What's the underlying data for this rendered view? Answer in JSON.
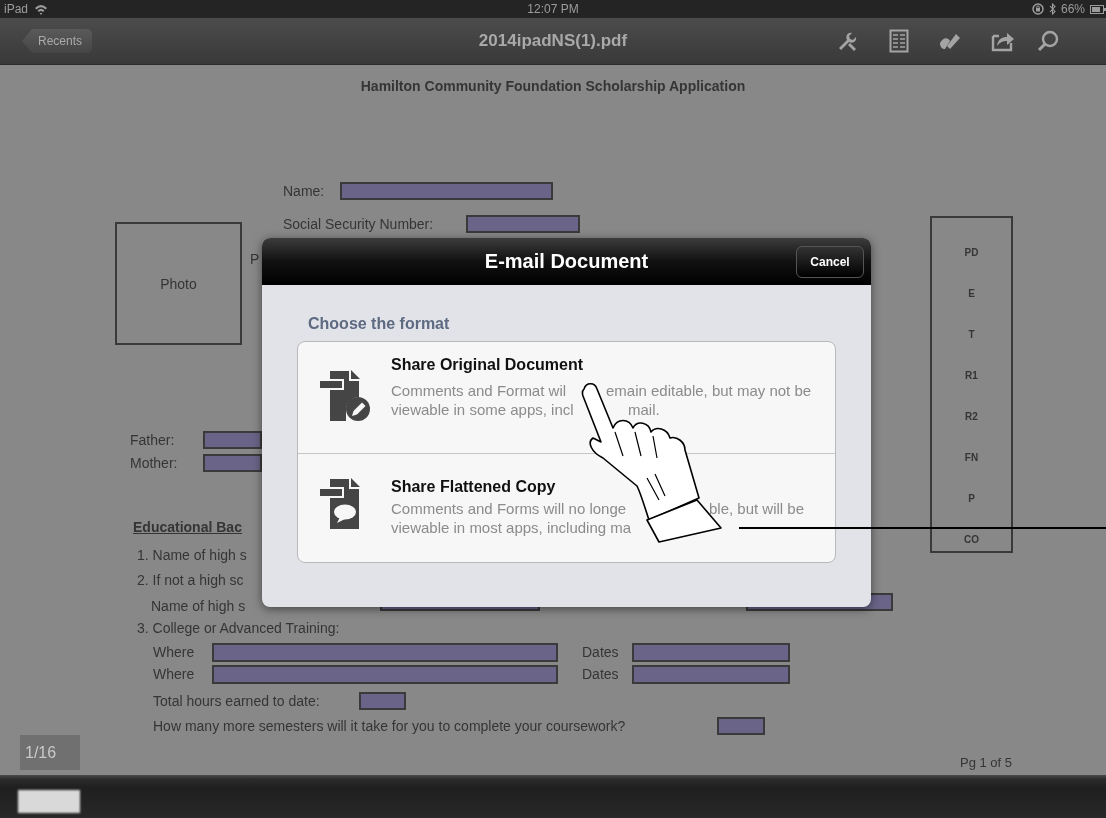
{
  "status_bar": {
    "device": "iPad",
    "time": "12:07 PM",
    "battery": "66%"
  },
  "nav_bar": {
    "back": "Recents",
    "title": "2014ipadNS(1).pdf"
  },
  "document": {
    "title": "Hamilton Community Foundation Scholarship Application",
    "photo_label": "Photo",
    "cut_label": "P",
    "top_fields": [
      "Name:",
      "Social Security Number:"
    ],
    "parents": [
      "Father:",
      "Mother:"
    ],
    "section_heading": "Educational Bac",
    "items": [
      "1. Name of high s",
      "2. If not a high sc"
    ],
    "sub_item": "Name of high s",
    "college": "3. College or Advanced Training:",
    "college_rows": [
      {
        "where": "Where",
        "dates": "Dates"
      },
      {
        "where": "Where",
        "dates": "Dates"
      }
    ],
    "total_hours": "Total hours earned to date:",
    "semesters": "How many more semesters will it take for you to complete your coursework?",
    "codes": [
      "PD",
      "E",
      "T",
      "R1",
      "R2",
      "FN",
      "P",
      "CO"
    ],
    "page_label": "Pg 1 of 5"
  },
  "page_indicator": "1/16",
  "dialog": {
    "title": "E-mail Document",
    "cancel": "Cancel",
    "subtitle": "Choose the format",
    "options": [
      {
        "kind": "original",
        "title": "Share Original Document",
        "description": [
          [
            "Comments and Format wil",
            "emain editable, but may not be"
          ],
          [
            "viewable in some apps, incl",
            "mail."
          ]
        ]
      },
      {
        "kind": "flattened",
        "title": "Share Flattened Copy",
        "description": [
          [
            "Comments and Forms will no longe",
            "ble, but will be"
          ],
          [
            "viewable in most apps, including ma"
          ]
        ]
      }
    ]
  }
}
